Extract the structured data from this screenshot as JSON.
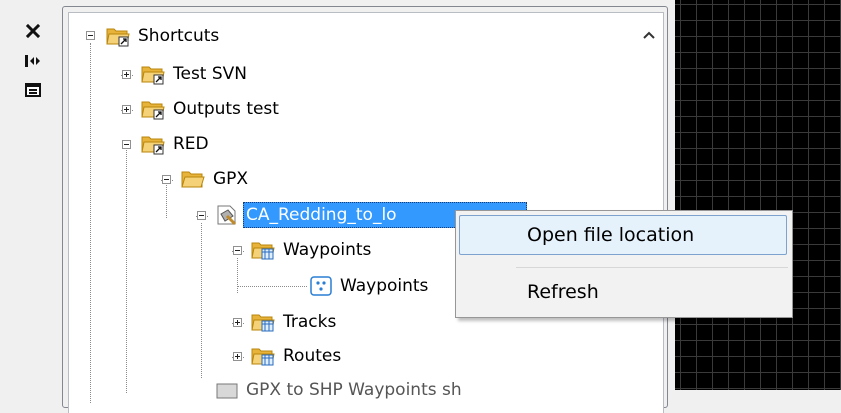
{
  "toolbar": {
    "icons": [
      "close-icon",
      "expand-collapse-icon",
      "panel-icon"
    ]
  },
  "tree": {
    "nodes": {
      "shortcuts": "Shortcuts",
      "test_svn": "Test SVN",
      "outputs_test": "Outputs test",
      "red": "RED",
      "gpx": "GPX",
      "ca_redding": "CA_Redding_to_lo",
      "waypoints_folder": "Waypoints",
      "waypoints_layer": "Waypoints",
      "tracks": "Tracks",
      "routes": "Routes",
      "gpx_to_shp": "GPX to SHP Waypoints sh"
    }
  },
  "context_menu": {
    "items": [
      "Open file location",
      "Refresh"
    ]
  },
  "colors": {
    "selection": "#3399ff",
    "menu_hover": "#e5f1fb",
    "folder": "#f5c542",
    "grid_background": "#000000"
  }
}
